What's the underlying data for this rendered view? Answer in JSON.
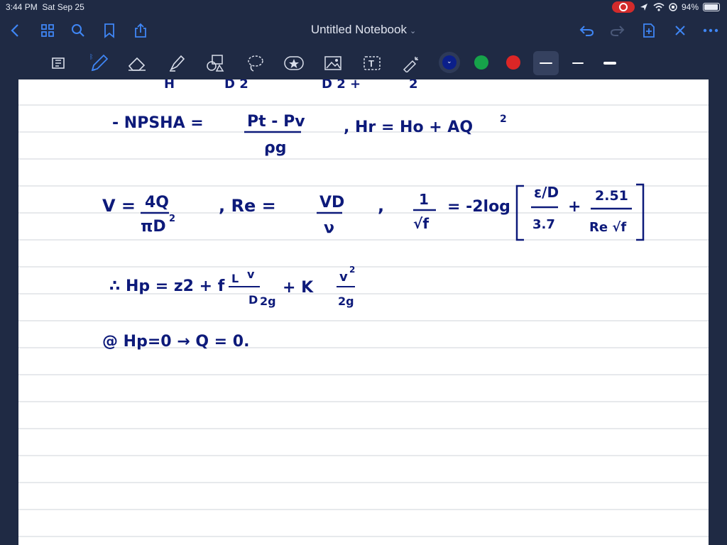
{
  "status_bar": {
    "time": "3:44 PM",
    "date": "Sat Sep 25",
    "battery": "94%",
    "battery_level": 0.94
  },
  "nav": {
    "title": "Untitled Notebook",
    "icons": [
      "back-icon",
      "grid-icon",
      "search-icon",
      "bookmark-icon",
      "share-icon",
      "undo-icon",
      "redo-icon",
      "add-page-icon",
      "close-icon",
      "more-icon"
    ]
  },
  "toolbar": {
    "tools": [
      "scan-icon",
      "pen-icon",
      "eraser-icon",
      "highlighter-icon",
      "shapes-icon",
      "lasso-icon",
      "sticker-icon",
      "image-icon",
      "text-icon",
      "laser-icon"
    ],
    "colors": [
      "#0b1f8a",
      "#16a34a",
      "#dc2626"
    ],
    "selected_color": "#0b1f8a"
  },
  "notes": {
    "line1": "- NPSHA = (Pt - Pv)/ρg , Hr = Ho + AQ²",
    "line1_lhs": "- NPSHA =",
    "line1_num": "Pt - Pv",
    "line1_den": "ρg",
    "line1_rhs": ", Hr = Ho + AQ",
    "line1_exp": "2",
    "v_lhs": "V =",
    "v_num": "4Q",
    "v_den": "πD",
    "v_exp": "2",
    "re_lhs": ", Re =",
    "re_num": "VD",
    "re_den": "ν",
    "f_num": "1",
    "f_den": "√f",
    "f_eq": "= -2log",
    "f_t1_num": "ε/D",
    "f_t1_den": "3.7",
    "f_plus": "+",
    "f_t2_num": "2.51",
    "f_t2_den": "Re √f",
    "hp_lhs": "∴ Hp = z2 + f",
    "hp_L": "L",
    "hp_D": "D",
    "hp_v": "v",
    "hp_2g": "2g",
    "hp_plus": "+ K",
    "hp_v2": "v",
    "hp_2g2": "2g",
    "hp_sq": "2",
    "last_line": "@ Hp=0 → Q = 0.",
    "top_cut_1": "H",
    "top_cut_2": "D 2",
    "top_cut_3": "D 2 +",
    "top_cut_4": "2"
  }
}
